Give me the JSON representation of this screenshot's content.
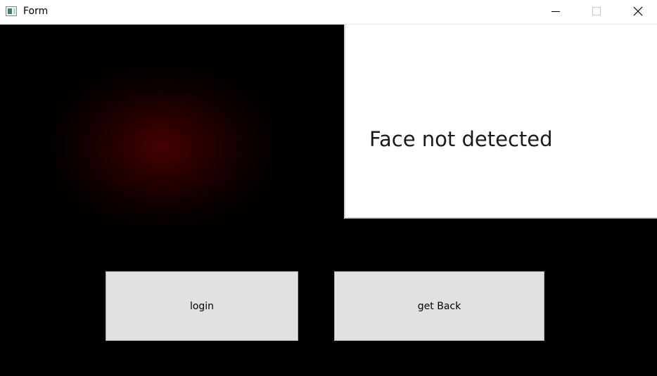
{
  "window": {
    "title": "Form",
    "controls": {
      "minimize_icon": "minimize-icon",
      "maximize_icon": "maximize-icon",
      "close_icon": "close-icon"
    }
  },
  "camera": {
    "glow_color": "#460000"
  },
  "status": {
    "message": "Face not detected"
  },
  "buttons": {
    "login_label": "login",
    "back_label": "get Back"
  },
  "colors": {
    "background": "#000000",
    "panel": "#ffffff",
    "button": "#e1e1e1"
  }
}
